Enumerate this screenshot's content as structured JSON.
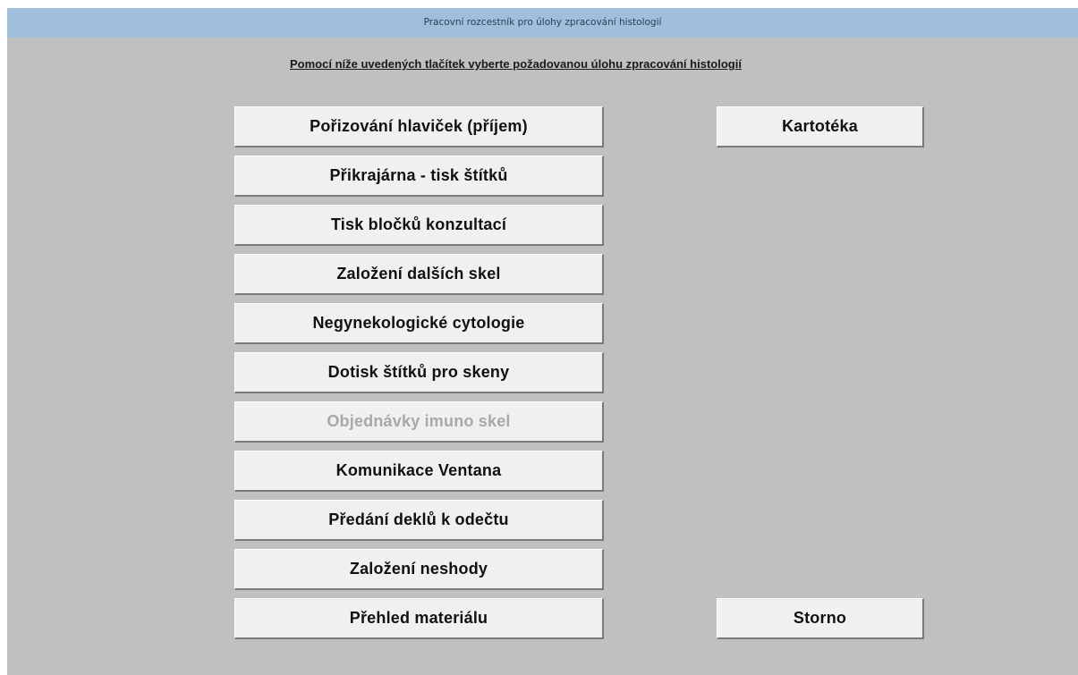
{
  "window": {
    "title": "Pracovní rozcestník pro úlohy zpracování histologií"
  },
  "instruction": "Pomocí níže uvedených tlačítek vyberte požadovanou úlohu zpracování histologií",
  "buttons": {
    "main": [
      {
        "label": "Pořizování hlaviček (příjem)",
        "enabled": true
      },
      {
        "label": "Přikrajárna - tisk štítků",
        "enabled": true
      },
      {
        "label": "Tisk bločků konzultací",
        "enabled": true
      },
      {
        "label": "Založení dalších skel",
        "enabled": true
      },
      {
        "label": "Negynekologické cytologie",
        "enabled": true
      },
      {
        "label": "Dotisk štítků pro skeny",
        "enabled": true
      },
      {
        "label": "Objednávky imuno skel",
        "enabled": false
      },
      {
        "label": "Komunikace Ventana",
        "enabled": true
      },
      {
        "label": "Předání deklů k odečtu",
        "enabled": true
      },
      {
        "label": "Založení neshody",
        "enabled": true
      },
      {
        "label": "Přehled materiálu",
        "enabled": true
      }
    ],
    "kartoteka": "Kartotéka",
    "storno": "Storno"
  }
}
